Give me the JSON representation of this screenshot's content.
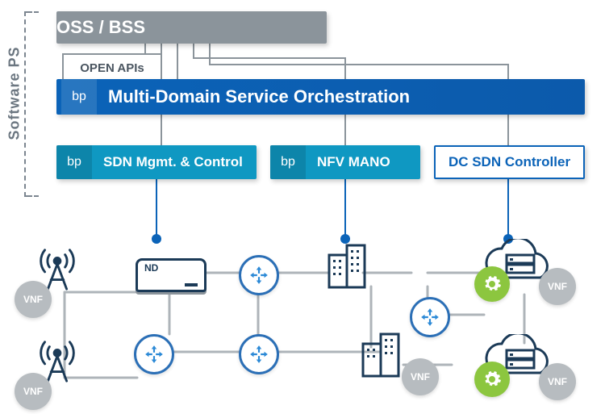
{
  "sidebar": {
    "label": "Software PS"
  },
  "oss": {
    "label": "OSS / BSS"
  },
  "open_apis": {
    "label": "OPEN APIs"
  },
  "mdso": {
    "bp": "bp",
    "label": "Multi-Domain Service Orchestration"
  },
  "sdn": {
    "bp": "bp",
    "label": "SDN Mgmt. & Control"
  },
  "nfv": {
    "bp": "bp",
    "label": "NFV MANO"
  },
  "dcsdn": {
    "label": "DC SDN Controller"
  },
  "network": {
    "vnf_label": "VNF",
    "nd_label": "ND"
  }
}
